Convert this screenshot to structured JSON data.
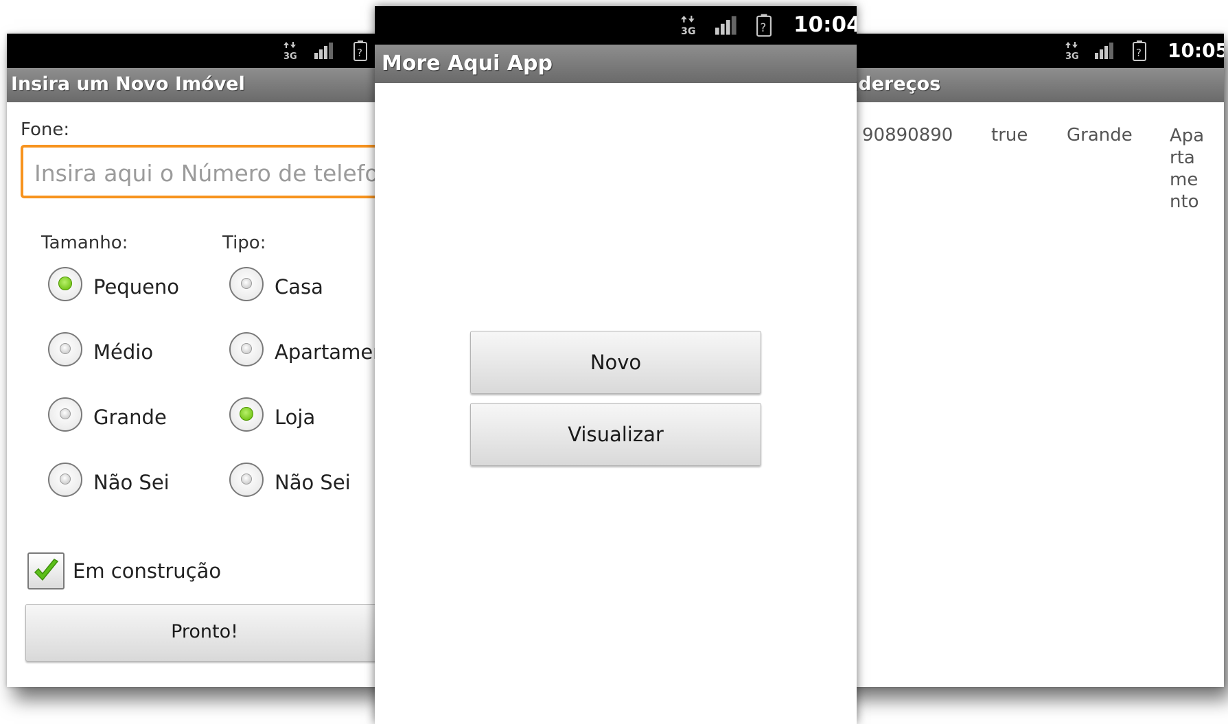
{
  "statusbar": {
    "network_icon": "3g-icon",
    "signal_icon": "signal-icon",
    "battery_icon": "battery-unknown-icon"
  },
  "form_screen": {
    "title": "Insira um Novo Imóvel",
    "phone_label": "Fone:",
    "phone_placeholder": "Insira aqui o Número de telefo",
    "size_label": "Tamanho:",
    "type_label": "Tipo:",
    "size_options": [
      {
        "label": "Pequeno",
        "selected": true
      },
      {
        "label": "Médio",
        "selected": false
      },
      {
        "label": "Grande",
        "selected": false
      },
      {
        "label": "Não Sei",
        "selected": false
      }
    ],
    "type_options": [
      {
        "label": "Casa",
        "selected": false
      },
      {
        "label": "Apartamen",
        "selected": false
      },
      {
        "label": "Loja",
        "selected": true
      },
      {
        "label": "Não Sei",
        "selected": false
      }
    ],
    "construction_label": "Em construção",
    "construction_checked": true,
    "submit_label": "Pronto!"
  },
  "main_screen": {
    "time": "10:04",
    "title": "More Aqui App",
    "new_button": "Novo",
    "view_button": "Visualizar"
  },
  "list_screen": {
    "time": "10:05",
    "title": "e Endereços",
    "row": {
      "phone": "90890890",
      "construction": "true",
      "size": "Grande",
      "type_lines": [
        "Apa",
        "rta",
        "me",
        "nto"
      ]
    }
  },
  "colors": {
    "focus_border": "#f7931e",
    "selected_radio": "#66c000",
    "check_mark": "#5cbf1a"
  }
}
